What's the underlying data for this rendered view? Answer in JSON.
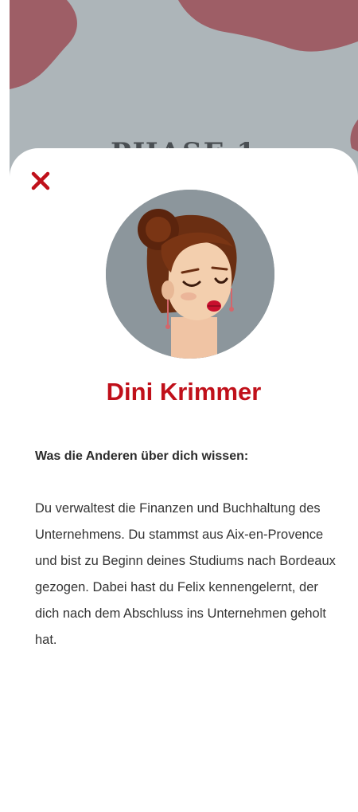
{
  "background": {
    "heading": "PHASE 1"
  },
  "colors": {
    "accent": "#c0101a",
    "background_panel": "#adb5b9",
    "background_blob": "#9e5e66",
    "avatar_bg": "#8c969c"
  },
  "profile": {
    "close_icon": "close-icon",
    "name": "Dini Krimmer",
    "section_title": "Was die Anderen über dich wissen:",
    "description": "Du verwaltest die Finanzen und Buchhaltung des Unternehmens. Du stammst aus Aix-en-Provence und bist zu Beginn deines Studiums nach Bordeaux gezogen. Dabei hast du Felix kennengelernt, der dich nach dem Abschluss ins Unternehmen geholt hat."
  }
}
